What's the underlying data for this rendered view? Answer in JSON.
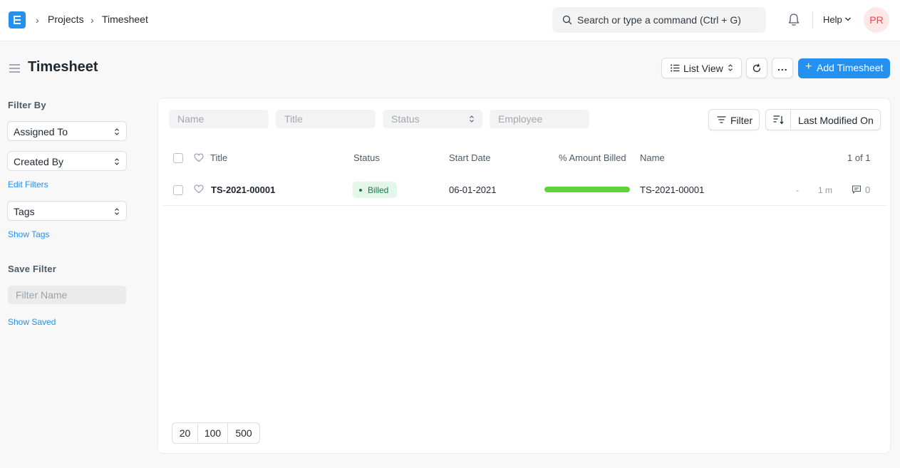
{
  "breadcrumbs": [
    "Projects",
    "Timesheet"
  ],
  "search": {
    "placeholder": "Search or type a command (Ctrl + G)"
  },
  "nav": {
    "help_label": "Help",
    "avatar_initials": "PR"
  },
  "page": {
    "title": "Timesheet"
  },
  "toolbar": {
    "view_label": "List View",
    "add_label": "Add Timesheet",
    "more_label": "..."
  },
  "sidebar": {
    "filter_by_label": "Filter By",
    "assigned_to_label": "Assigned To",
    "created_by_label": "Created By",
    "edit_filters_label": "Edit Filters",
    "tags_label": "Tags",
    "show_tags_label": "Show Tags",
    "save_filter_label": "Save Filter",
    "filter_name_placeholder": "Filter Name",
    "show_saved_label": "Show Saved"
  },
  "filters": {
    "name_placeholder": "Name",
    "title_placeholder": "Title",
    "status_placeholder": "Status",
    "employee_placeholder": "Employee",
    "filter_label": "Filter",
    "sort_label": "Last Modified On"
  },
  "table": {
    "columns": {
      "title": "Title",
      "status": "Status",
      "start_date": "Start Date",
      "amount_billed": "% Amount Billed",
      "name": "Name"
    },
    "count_label": "1 of 1",
    "rows": [
      {
        "title": "TS-2021-00001",
        "status": "Billed",
        "start_date": "06-01-2021",
        "amount_billed_percent": 100,
        "name": "TS-2021-00001",
        "dash": "-",
        "modified": "1 m",
        "comments": "0"
      }
    ]
  },
  "paging": {
    "sizes": [
      "20",
      "100",
      "500"
    ]
  },
  "colors": {
    "primary": "#2490ef",
    "billed_bg": "#e4f5e9",
    "billed_text": "#16794c",
    "progress": "#5fd338"
  }
}
